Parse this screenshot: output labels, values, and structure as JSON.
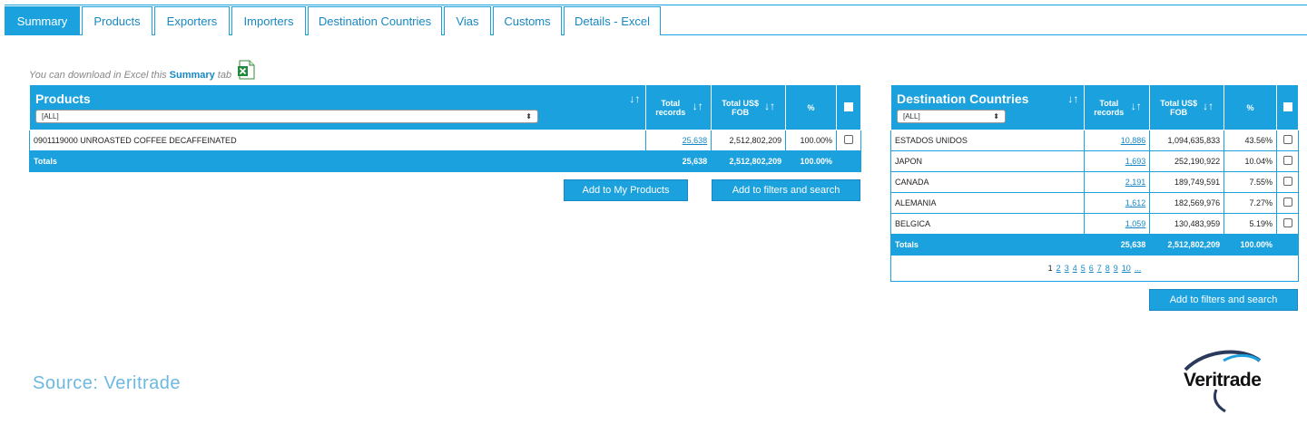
{
  "tabs": [
    {
      "label": "Summary",
      "active": true
    },
    {
      "label": "Products",
      "active": false
    },
    {
      "label": "Exporters",
      "active": false
    },
    {
      "label": "Importers",
      "active": false
    },
    {
      "label": "Destination Countries",
      "active": false
    },
    {
      "label": "Vias",
      "active": false
    },
    {
      "label": "Customs",
      "active": false
    },
    {
      "label": "Details - Excel",
      "active": false
    }
  ],
  "note": {
    "prefix": "You can download in Excel this",
    "highlight": "Summary",
    "suffix": "tab"
  },
  "products": {
    "title": "Products",
    "filter": "[ALL]",
    "col_total_records": "Total records",
    "col_total_fob_1": "Total US$",
    "col_total_fob_2": "FOB",
    "col_pct": "%",
    "rows": [
      {
        "name": "0901119000 UNROASTED COFFEE DECAFFEINATED",
        "records": "25,638",
        "fob": "2,512,802,209",
        "pct": "100.00%"
      }
    ],
    "totals": {
      "label": "Totals",
      "records": "25,638",
      "fob": "2,512,802,209",
      "pct": "100.00%"
    }
  },
  "buttons": {
    "add_products": "Add to My Products",
    "add_filters_left": "Add to filters and search",
    "add_filters_right": "Add to filters and search"
  },
  "destinations": {
    "title": "Destination Countries",
    "filter": "[ALL]",
    "col_total_records": "Total records",
    "col_total_fob_1": "Total US$",
    "col_total_fob_2": "FOB",
    "col_pct": "%",
    "rows": [
      {
        "name": "ESTADOS UNIDOS",
        "records": "10,886",
        "fob": "1,094,635,833",
        "pct": "43.56%"
      },
      {
        "name": "JAPON",
        "records": "1,693",
        "fob": "252,190,922",
        "pct": "10.04%"
      },
      {
        "name": "CANADA",
        "records": "2,191",
        "fob": "189,749,591",
        "pct": "7.55%"
      },
      {
        "name": "ALEMANIA",
        "records": "1,612",
        "fob": "182,569,976",
        "pct": "7.27%"
      },
      {
        "name": "BELGICA",
        "records": "1,059",
        "fob": "130,483,959",
        "pct": "5.19%"
      }
    ],
    "totals": {
      "label": "Totals",
      "records": "25,638",
      "fob": "2,512,802,209",
      "pct": "100.00%"
    }
  },
  "pager": {
    "current": "1",
    "pages": [
      "2",
      "3",
      "4",
      "5",
      "6",
      "7",
      "8",
      "9",
      "10",
      "..."
    ]
  },
  "source": "Source: Veritrade",
  "logo": "Veritrade",
  "colors": {
    "accent": "#1ba1de",
    "link": "#1788c4",
    "source": "#6cb8e0"
  },
  "icons": {
    "sort": "sort-arrows-icon",
    "excel": "excel-icon",
    "checkbox": "checkbox-icon",
    "dropdown": "dropdown-arrow-icon"
  }
}
